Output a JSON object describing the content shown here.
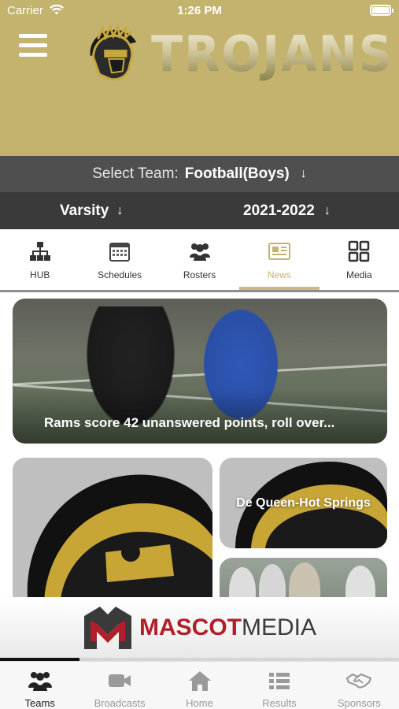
{
  "status_bar": {
    "carrier": "Carrier",
    "time": "1:26 PM"
  },
  "header": {
    "logo_text": "TROJANS",
    "bg_color": "#c3b36e"
  },
  "team_selector": {
    "label": "Select Team:",
    "value": "Football(Boys)"
  },
  "level": {
    "value": "Varsity"
  },
  "season": {
    "value": "2021-2022"
  },
  "tabs": [
    {
      "label": "HUB",
      "icon": "org-chart-icon",
      "active": false
    },
    {
      "label": "Schedules",
      "icon": "calendar-icon",
      "active": false
    },
    {
      "label": "Rosters",
      "icon": "people-icon",
      "active": false
    },
    {
      "label": "News",
      "icon": "newspaper-icon",
      "active": true
    },
    {
      "label": "Media",
      "icon": "grid-icon",
      "active": false
    }
  ],
  "news": [
    {
      "title": "Rams score 42 unanswered points, roll over..."
    },
    {
      "title": ""
    },
    {
      "title": "De Queen-Hot Springs"
    },
    {
      "title": ""
    }
  ],
  "ad": {
    "brand_part1": "MASCOT",
    "brand_part2": "MEDIA",
    "progress": 0.2
  },
  "bottom_nav": [
    {
      "label": "Teams",
      "icon": "team-icon",
      "active": true
    },
    {
      "label": "Broadcasts",
      "icon": "video-camera-icon",
      "active": false
    },
    {
      "label": "Home",
      "icon": "home-icon",
      "active": false
    },
    {
      "label": "Results",
      "icon": "list-icon",
      "active": false
    },
    {
      "label": "Sponsors",
      "icon": "handshake-icon",
      "active": false
    }
  ],
  "colors": {
    "accent": "#c3b36e",
    "dark_bar": "#4f4f4f",
    "darker_bar": "#3a3a3a",
    "brand_red": "#b11f2b"
  }
}
